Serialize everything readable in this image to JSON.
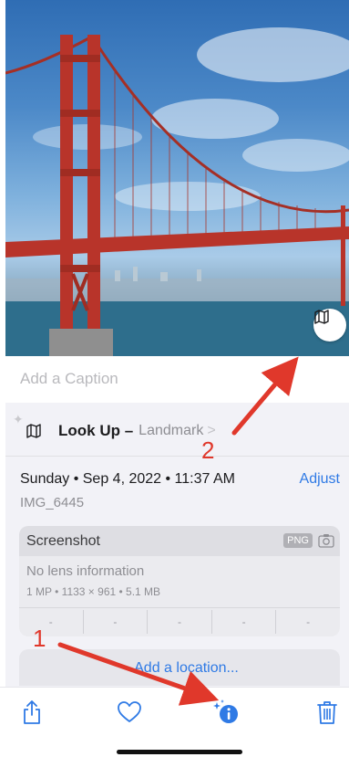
{
  "caption_placeholder": "Add a Caption",
  "lookup": {
    "title": "Look Up –",
    "subtitle": "Landmark",
    "chevron": ">"
  },
  "meta": {
    "date": "Sunday • Sep 4, 2022 • 11:37 AM",
    "adjust_label": "Adjust",
    "filename": "IMG_6445"
  },
  "card": {
    "title": "Screenshot",
    "format_badge": "PNG",
    "lens": "No lens information",
    "specs": "1 MP • 1133 × 961 • 5.1 MB",
    "exif": [
      "-",
      "-",
      "-",
      "-",
      "-"
    ]
  },
  "location_label": "Add a location...",
  "toolbar": {
    "share_icon": "share-icon",
    "favorite_icon": "heart-icon",
    "info_icon": "info-sparkle-icon",
    "delete_icon": "trash-icon"
  },
  "annotations": {
    "marker_1": "1",
    "marker_2": "2",
    "color": "#e0382b"
  },
  "colors": {
    "accent": "#2f7ae5",
    "bridge": "#b8342a"
  }
}
